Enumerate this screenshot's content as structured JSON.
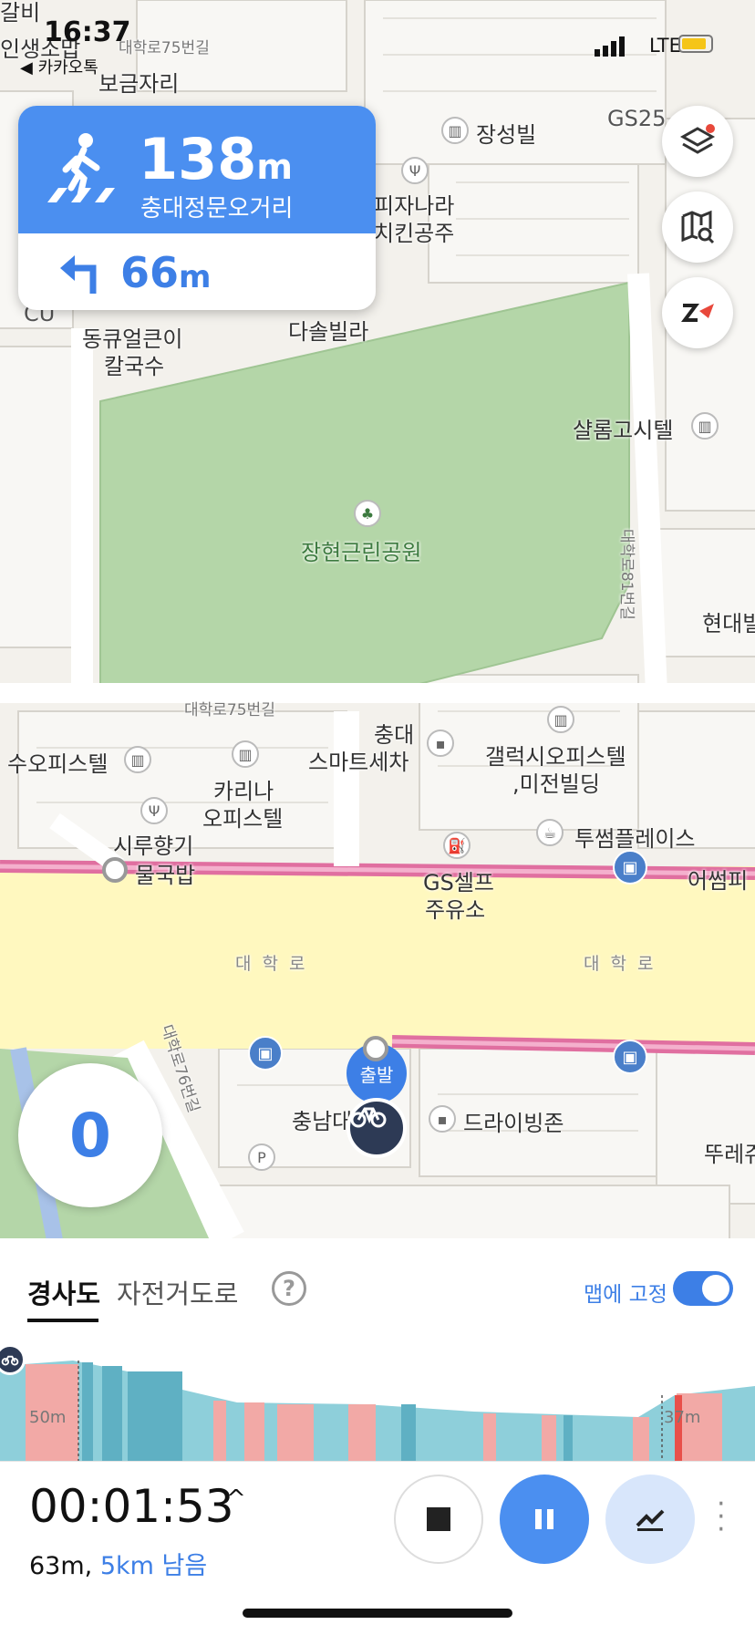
{
  "status_bar": {
    "time": "16:37",
    "back_app": "◀ 카카오톡",
    "network": "LTE"
  },
  "map": {
    "labels": {
      "top_left_1": "갈비",
      "top_left_2": "인생소맙",
      "road_top": "대학로75번길",
      "bogeum": "보금자리",
      "gs25": "GS25",
      "jangseong": "장성빌",
      "pizza1": "피자나라",
      "pizza2": "치킨공주",
      "dongkyu1": "동큐얼큰이",
      "dongkyu2": "칼국수",
      "dasol": "다솔빌라",
      "cu": "CU",
      "shalom": "샬롬고시텔",
      "park": "장현근린공원",
      "road_81": "대학로81번길",
      "hyundae": "현대빌",
      "road_75b": "대학로75번길",
      "chungdae1": "충대",
      "chungdae2": "스마트세차",
      "galaxy1": "갤럭시오피스텔",
      "galaxy2": ",미전빌딩",
      "suo": "수오피스텔",
      "karina1": "카리나",
      "karina2": "오피스텔",
      "siru1": "시루향기",
      "siru2": "물국밥",
      "tusome": "투썸플레이스",
      "eosom": "어썸피",
      "gs_self1": "GS셀프",
      "gs_self2": "주유소",
      "daehakro1": "대 학 로",
      "daehakro2": "대 학 로",
      "road_76": "대학로76번길",
      "chungnam": "충남대",
      "drivingzone": "드라이빙존",
      "ttureju": "뚜레쥬",
      "start": "출발"
    }
  },
  "nav_card": {
    "distance": "138",
    "distance_unit": "m",
    "street": "충대정문오거리",
    "next_distance": "66",
    "next_unit": "m"
  },
  "speed": "0",
  "panel": {
    "tab_active": "경사도",
    "tab_other": "자전거도로",
    "help": "?",
    "pin_label": "맵에 고정",
    "elevation_left": "50m",
    "elevation_right": "37m"
  },
  "controls": {
    "elapsed": "00:01:53",
    "distance_done": "63m,",
    "remaining": "5km 남음"
  },
  "colors": {
    "accent": "#4b8ff0",
    "park": "#b4d6a8",
    "road": "#fff8bf",
    "route": "#e06fa0"
  }
}
